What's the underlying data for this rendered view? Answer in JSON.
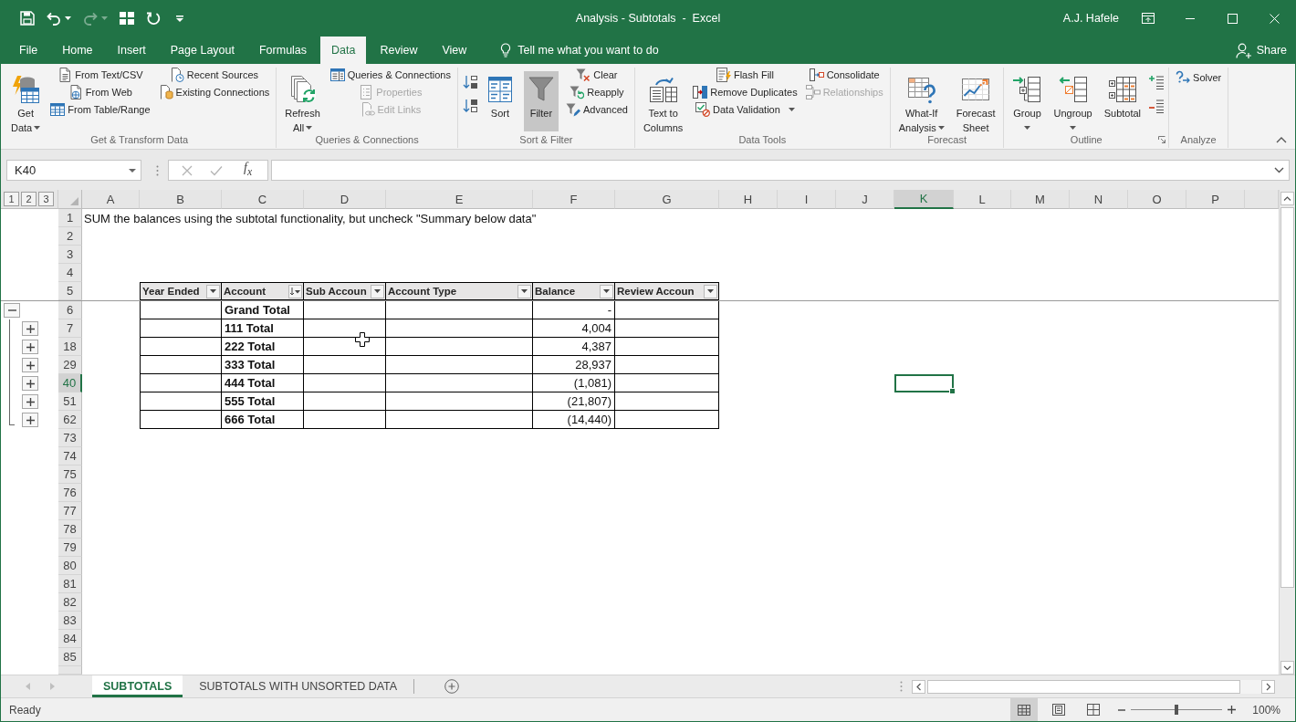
{
  "window": {
    "title": "Analysis - Subtotals  -  Excel",
    "user": "A.J. Hafele"
  },
  "quick_access": [
    {
      "kind": "save",
      "disabled": false
    },
    {
      "kind": "undo",
      "disabled": false
    },
    {
      "kind": "undo_menu",
      "disabled": false
    },
    {
      "kind": "redo",
      "disabled": true
    },
    {
      "kind": "redo_menu",
      "disabled": true
    },
    {
      "kind": "touch",
      "disabled": false
    },
    {
      "kind": "repeat",
      "disabled": false
    },
    {
      "kind": "customize",
      "disabled": false
    }
  ],
  "tabs": [
    {
      "label": "File",
      "selected": false
    },
    {
      "label": "Home",
      "selected": false
    },
    {
      "label": "Insert",
      "selected": false
    },
    {
      "label": "Page Layout",
      "selected": false
    },
    {
      "label": "Formulas",
      "selected": false
    },
    {
      "label": "Data",
      "selected": true
    },
    {
      "label": "Review",
      "selected": false
    },
    {
      "label": "View",
      "selected": false
    }
  ],
  "tell_me": {
    "placeholder": "Tell me what you want to do"
  },
  "share": {
    "label": "Share"
  },
  "ribbon": {
    "groups": [
      {
        "label": "Get & Transform Data",
        "columns": [
          {
            "kind": "large",
            "items": [
              {
                "lines": [
                  "Get",
                  "Data"
                ],
                "dropdown": true,
                "pressed": false
              }
            ]
          },
          {
            "kind": "small",
            "items": [
              {
                "label": "From Text/CSV",
                "disabled": false
              },
              {
                "label": "From Web",
                "disabled": false
              },
              {
                "label": "From Table/Range",
                "disabled": false
              }
            ]
          },
          {
            "kind": "small",
            "items": [
              {
                "label": "Recent Sources",
                "disabled": false
              },
              {
                "label": "Existing Connections",
                "disabled": false
              }
            ]
          }
        ]
      },
      {
        "label": "Queries & Connections",
        "columns": [
          {
            "kind": "large",
            "items": [
              {
                "lines": [
                  "Refresh",
                  "All"
                ],
                "dropdown": true,
                "pressed": false
              }
            ]
          },
          {
            "kind": "small",
            "items": [
              {
                "label": "Queries & Connections",
                "disabled": false
              },
              {
                "label": "Properties",
                "disabled": true
              },
              {
                "label": "Edit Links",
                "disabled": true
              }
            ]
          }
        ]
      },
      {
        "label": "Sort & Filter",
        "columns": [
          {
            "kind": "icons",
            "items": [
              {
                "disabled": false
              },
              {
                "disabled": false
              }
            ]
          },
          {
            "kind": "large",
            "items": [
              {
                "lines": [
                  "Sort"
                ],
                "pressed": false
              }
            ]
          },
          {
            "kind": "large",
            "items": [
              {
                "lines": [
                  "Filter"
                ],
                "pressed": true
              }
            ]
          },
          {
            "kind": "small",
            "items": [
              {
                "label": "Clear",
                "disabled": false
              },
              {
                "label": "Reapply",
                "disabled": false
              },
              {
                "label": "Advanced",
                "disabled": false
              }
            ]
          }
        ]
      },
      {
        "label": "Data Tools",
        "columns": [
          {
            "kind": "large",
            "items": [
              {
                "lines": [
                  "Text to",
                  "Columns"
                ],
                "pressed": false
              }
            ]
          },
          {
            "kind": "small",
            "items": [
              {
                "label": "Flash Fill",
                "disabled": false
              },
              {
                "label": "Remove Duplicates",
                "disabled": false
              },
              {
                "label": "Data Validation",
                "dropdown": true,
                "disabled": false
              }
            ]
          },
          {
            "kind": "small",
            "items": [
              {
                "label": "Consolidate",
                "disabled": false
              },
              {
                "label": "Relationships",
                "disabled": true
              }
            ]
          }
        ]
      },
      {
        "label": "Forecast",
        "columns": [
          {
            "kind": "large",
            "items": [
              {
                "lines": [
                  "What-If",
                  "Analysis"
                ],
                "dropdown": true,
                "pressed": false
              }
            ]
          },
          {
            "kind": "large",
            "items": [
              {
                "lines": [
                  "Forecast",
                  "Sheet"
                ],
                "pressed": false
              }
            ]
          }
        ]
      },
      {
        "label": "Outline",
        "launcher": true,
        "columns": [
          {
            "kind": "large",
            "items": [
              {
                "lines": [
                  "Group"
                ],
                "dropdown": true,
                "pressed": false
              }
            ]
          },
          {
            "kind": "large",
            "items": [
              {
                "lines": [
                  "Ungroup"
                ],
                "dropdown": true,
                "pressed": false
              }
            ]
          },
          {
            "kind": "large",
            "items": [
              {
                "lines": [
                  "Subtotal"
                ],
                "pressed": false
              }
            ]
          },
          {
            "kind": "icons",
            "items": [
              {
                "disabled": false
              },
              {
                "disabled": false
              }
            ]
          }
        ]
      },
      {
        "label": "Analyze",
        "columns": [
          {
            "kind": "small",
            "items": [
              {
                "label": "Solver",
                "disabled": false
              }
            ]
          }
        ]
      }
    ]
  },
  "formula_bar": {
    "name_box": "K40",
    "buttons": [
      {
        "kind": "cancel",
        "disabled": true
      },
      {
        "kind": "enter",
        "disabled": true
      },
      {
        "kind": "function",
        "label": "f$_{x}$",
        "disabled": false
      }
    ]
  },
  "sheet": {
    "outline_levels": [
      "1",
      "2",
      "3"
    ],
    "columns": [
      {
        "label": "A",
        "selected": false
      },
      {
        "label": "B",
        "selected": false
      },
      {
        "label": "C",
        "selected": false
      },
      {
        "label": "D",
        "selected": false
      },
      {
        "label": "E",
        "selected": false
      },
      {
        "label": "F",
        "selected": false
      },
      {
        "label": "G",
        "selected": false
      },
      {
        "label": "H",
        "selected": false
      },
      {
        "label": "I",
        "selected": false
      },
      {
        "label": "J",
        "selected": false
      },
      {
        "label": "K",
        "selected": true
      },
      {
        "label": "L",
        "selected": false
      },
      {
        "label": "M",
        "selected": false
      },
      {
        "label": "N",
        "selected": false
      },
      {
        "label": "O",
        "selected": false
      },
      {
        "label": "P",
        "selected": false
      }
    ],
    "rows": [
      {
        "number": "1",
        "selected": false
      },
      {
        "number": "2",
        "selected": false
      },
      {
        "number": "3",
        "selected": false
      },
      {
        "number": "4",
        "selected": false
      },
      {
        "number": "5",
        "selected": false
      },
      {
        "number": "6",
        "selected": false,
        "outline": {
          "kind": "outer",
          "expanded": true
        }
      },
      {
        "number": "7",
        "selected": false,
        "outline": {
          "kind": "inner",
          "expanded": false
        }
      },
      {
        "number": "18",
        "selected": false,
        "outline": {
          "kind": "inner",
          "expanded": false
        }
      },
      {
        "number": "29",
        "selected": false,
        "outline": {
          "kind": "inner",
          "expanded": false
        }
      },
      {
        "number": "40",
        "selected": true,
        "outline": {
          "kind": "inner",
          "expanded": false
        }
      },
      {
        "number": "51",
        "selected": false,
        "outline": {
          "kind": "inner",
          "expanded": false
        }
      },
      {
        "number": "62",
        "selected": false,
        "outline": {
          "kind": "inner",
          "expanded": false
        }
      },
      {
        "number": "73",
        "selected": false
      },
      {
        "number": "74",
        "selected": false
      },
      {
        "number": "75",
        "selected": false
      },
      {
        "number": "76",
        "selected": false
      },
      {
        "number": "77",
        "selected": false
      },
      {
        "number": "78",
        "selected": false
      },
      {
        "number": "79",
        "selected": false
      },
      {
        "number": "80",
        "selected": false
      },
      {
        "number": "81",
        "selected": false
      },
      {
        "number": "82",
        "selected": false
      },
      {
        "number": "83",
        "selected": false
      },
      {
        "number": "84",
        "selected": false
      },
      {
        "number": "85",
        "selected": false
      }
    ],
    "note": "SUM the balances using the subtotal functionality, but uncheck \"Summary below data\"",
    "table": {
      "columns": [
        {
          "label": "Year Ended",
          "sorted": false
        },
        {
          "label": "Account",
          "sorted": true
        },
        {
          "label": "Sub Accoun",
          "sorted": false
        },
        {
          "label": "Account Type",
          "sorted": false
        },
        {
          "label": "Balance",
          "sorted": false
        },
        {
          "label": "Review Accoun",
          "sorted": false
        }
      ],
      "rows": [
        {
          "account": "Grand Total",
          "balance": "-"
        },
        {
          "account": "111 Total",
          "balance": "4,004"
        },
        {
          "account": "222 Total",
          "balance": "4,387"
        },
        {
          "account": "333 Total",
          "balance": "28,937"
        },
        {
          "account": "444 Total",
          "balance": "(1,081)"
        },
        {
          "account": "555 Total",
          "balance": "(21,807)"
        },
        {
          "account": "666 Total",
          "balance": "(14,440)"
        }
      ]
    }
  },
  "sheet_bar": {
    "nav": [
      {
        "kind": "previous",
        "disabled": true
      },
      {
        "kind": "next",
        "disabled": true
      }
    ],
    "tabs": [
      {
        "label": "SUBTOTALS",
        "selected": true
      },
      {
        "label": "SUBTOTALS WITH UNSORTED DATA",
        "selected": false
      }
    ]
  },
  "status_bar": {
    "text": "Ready",
    "views": [
      {
        "kind": "normal",
        "selected": true
      },
      {
        "kind": "page_layout",
        "selected": false
      },
      {
        "kind": "page_break",
        "selected": false
      }
    ],
    "zoom": {
      "level": 0.5,
      "reading": "100%"
    }
  }
}
